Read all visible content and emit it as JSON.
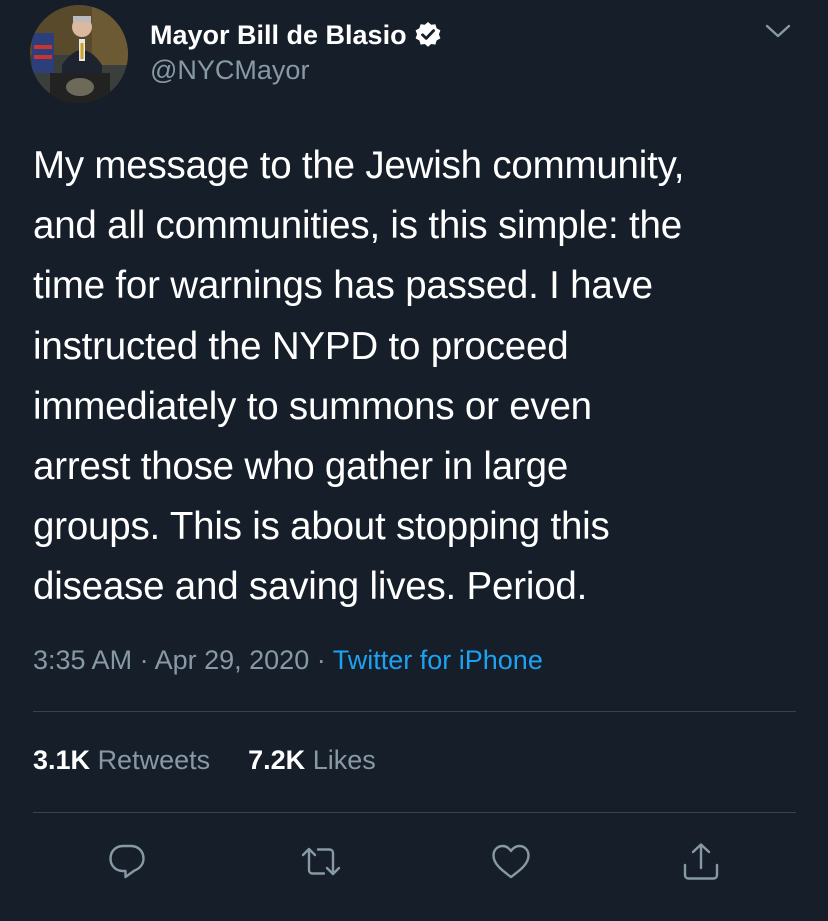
{
  "user": {
    "display_name": "Mayor Bill de Blasio",
    "handle": "@NYCMayor",
    "verified_icon": "verified-badge-icon",
    "avatar_icon": "profile-photo"
  },
  "menu_icon": "chevron-down-icon",
  "tweet": {
    "lines": [
      "My message to the Jewish community,",
      "and all communities, is this simple: the",
      "time for warnings has passed. I have",
      "instructed the NYPD to proceed",
      "immediately to summons or even",
      "arrest those who gather in large",
      "groups. This is about stopping this",
      "disease and saving lives. Period."
    ]
  },
  "meta": {
    "time": "3:35 AM",
    "separator": "·",
    "date": "Apr 29, 2020",
    "source": "Twitter for iPhone"
  },
  "stats": {
    "retweets_count": "3.1K",
    "retweets_label": "Retweets",
    "likes_count": "7.2K",
    "likes_label": "Likes"
  },
  "actions": [
    "reply-icon",
    "retweet-icon",
    "like-icon",
    "share-icon"
  ],
  "colors": {
    "background": "#151e29",
    "text": "#ffffff",
    "muted": "#8899a6",
    "link": "#1da1f2",
    "divider": "#38444d"
  }
}
